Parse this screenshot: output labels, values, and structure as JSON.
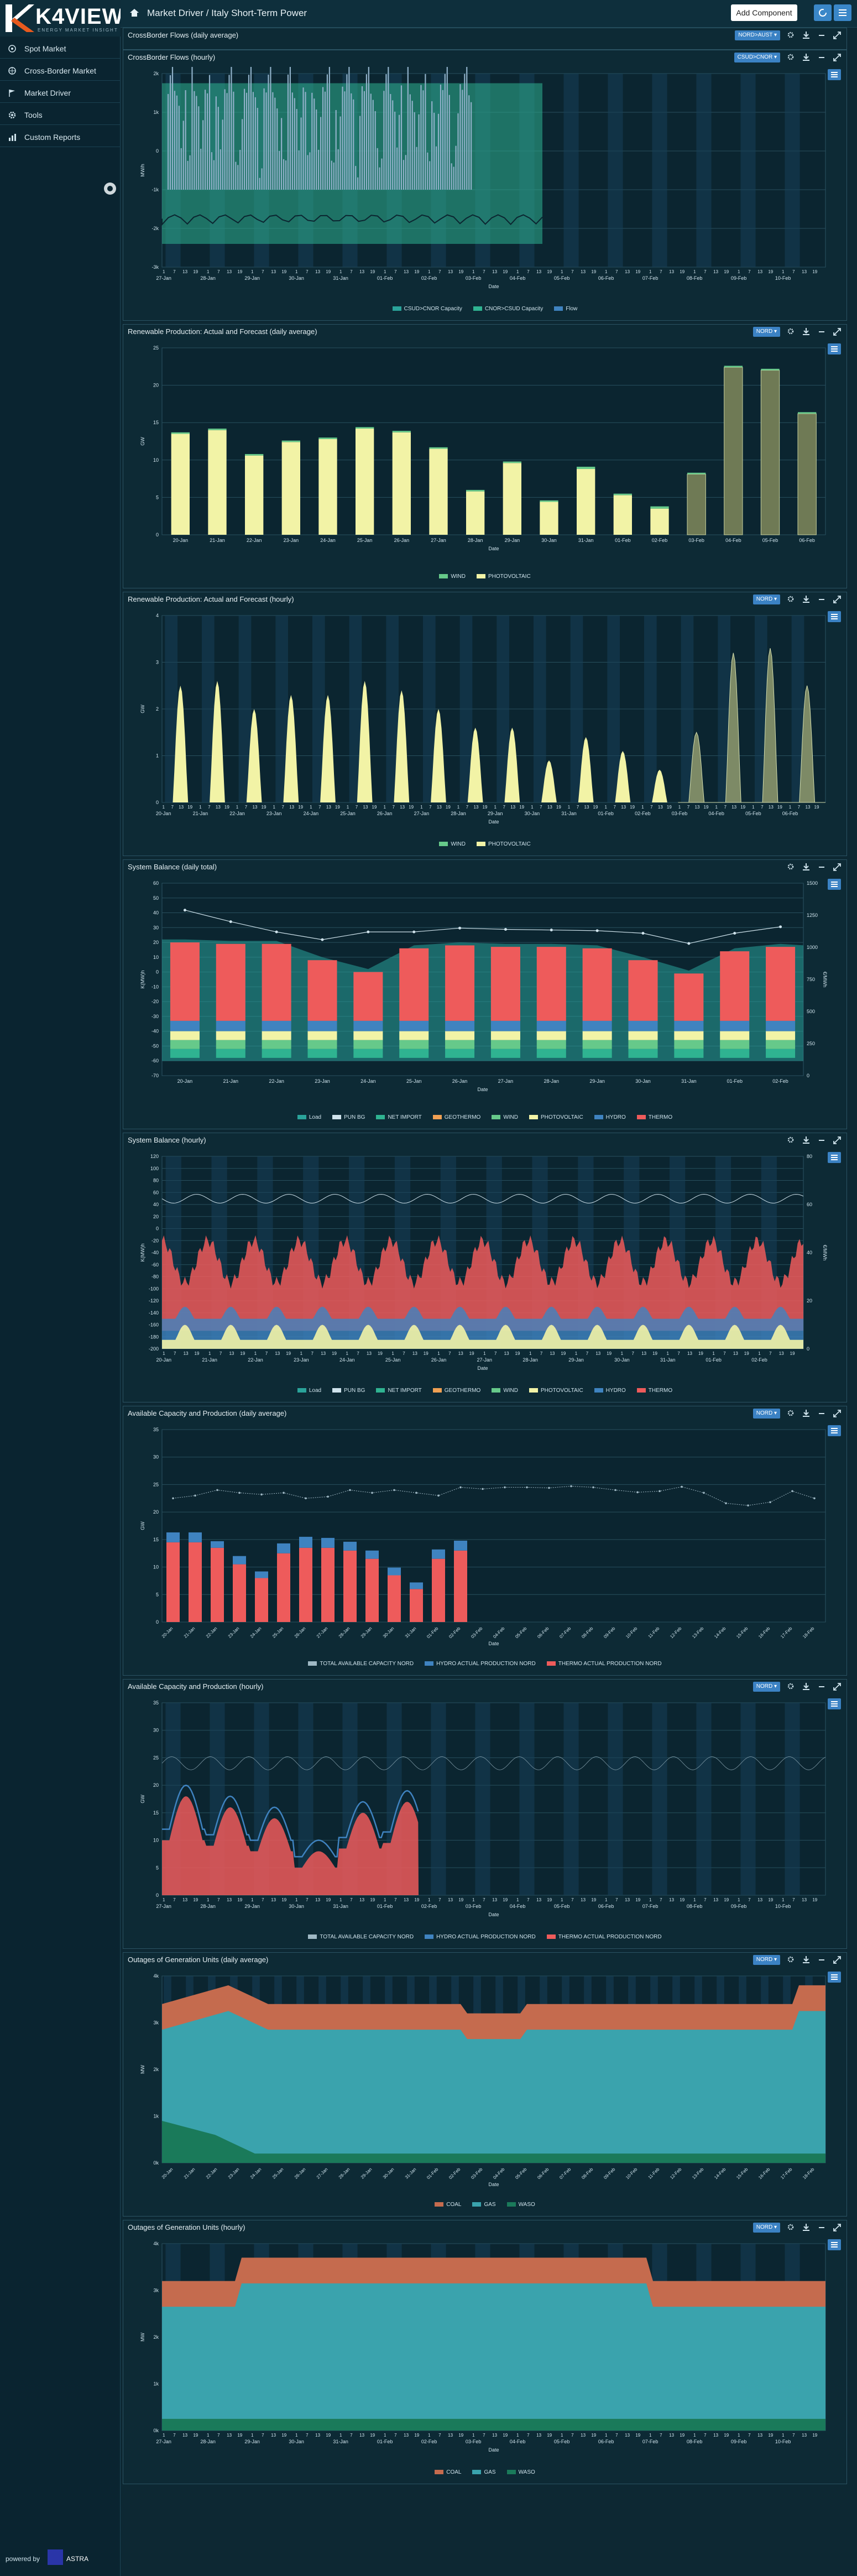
{
  "app": {
    "brand": "K4VIEW",
    "tagline": "ENERGY MARKET INSIGHT",
    "breadcrumb": "Market Driver / Italy Short-Term Power",
    "add_component": "Add Component",
    "powered_by": "powered by",
    "company": "ASTRA"
  },
  "sidebar": {
    "items": [
      {
        "label": "Spot Market",
        "icon": "spot-icon"
      },
      {
        "label": "Cross-Border Market",
        "icon": "crossborder-icon"
      },
      {
        "label": "Market Driver",
        "icon": "flag-icon"
      },
      {
        "label": "Tools",
        "icon": "gear-icon"
      },
      {
        "label": "Custom Reports",
        "icon": "chart-icon"
      }
    ]
  },
  "colors": {
    "accent": "#3b82c4",
    "bg": "#0d2833",
    "wind": "#66c98a",
    "pv": "#f2f3a6",
    "thermo": "#ee5b5b",
    "hydro": "#3f83c0",
    "geo": "#f0a053",
    "import": "#2fb391",
    "load": "#2aa39a",
    "coal": "#c56b4e",
    "gas": "#3aa3ad",
    "waso": "#1a7a5a",
    "flow": "#8fb0c8"
  },
  "panels": [
    {
      "title": "CrossBorder Flows (daily average)",
      "select": "NORD>AUST"
    },
    {
      "title": "CrossBorder Flows (hourly)",
      "select": "CSUD>CNOR",
      "chart_data": {
        "type": "area",
        "ylabel": "MW/h",
        "xlabel": "Date",
        "yticks": [
          "2k",
          "1k",
          "0",
          "-1k",
          "-2k",
          "-3k"
        ],
        "categories": [
          "27-Jan",
          "28-Jan",
          "29-Jan",
          "30-Jan",
          "31-Jan",
          "01-Feb",
          "02-Feb",
          "03-Feb",
          "04-Feb",
          "05-Feb",
          "06-Feb",
          "07-Feb",
          "08-Feb",
          "09-Feb",
          "10-Feb"
        ],
        "legend": [
          "CSUD>CNOR Capacity",
          "CNOR>CSUD Capacity",
          "Flow"
        ]
      }
    },
    {
      "title": "Renewable Production: Actual and Forecast (daily average)",
      "select": "NORD",
      "chart_data": {
        "type": "bar",
        "ylabel": "GW",
        "xlabel": "Date",
        "yticks": [
          "25",
          "20",
          "15",
          "10",
          "5",
          "0"
        ],
        "ylim": [
          0,
          25
        ],
        "categories": [
          "20-Jan",
          "21-Jan",
          "22-Jan",
          "23-Jan",
          "24-Jan",
          "25-Jan",
          "26-Jan",
          "27-Jan",
          "28-Jan",
          "29-Jan",
          "30-Jan",
          "31-Jan",
          "01-Feb",
          "02-Feb",
          "03-Feb",
          "04-Feb",
          "05-Feb",
          "06-Feb"
        ],
        "series": [
          {
            "name": "WIND",
            "values": [
              0.2,
              0.2,
              0.2,
              0.2,
              0.2,
              0.2,
              0.2,
              0.2,
              0.2,
              0.2,
              0.2,
              0.3,
              0.2,
              0.3,
              0.2,
              0.2,
              0.2,
              0.2
            ]
          },
          {
            "name": "PHOTOVOLTAIC",
            "values": [
              13.5,
              14,
              10.6,
              12.4,
              12.8,
              14.2,
              13.7,
              11.5,
              5.8,
              9.6,
              4.4,
              8.8,
              5.3,
              3.5,
              8.1,
              22.4,
              22,
              16.2
            ]
          }
        ],
        "legend": [
          "WIND",
          "PHOTOVOLTAIC"
        ]
      }
    },
    {
      "title": "Renewable Production: Actual and Forecast (hourly)",
      "select": "NORD",
      "chart_data": {
        "type": "area",
        "ylabel": "GW",
        "xlabel": "Date",
        "yticks": [
          "4",
          "3",
          "2",
          "1",
          "0"
        ],
        "ylim": [
          0,
          4
        ],
        "categories": [
          "20-Jan",
          "21-Jan",
          "22-Jan",
          "23-Jan",
          "24-Jan",
          "25-Jan",
          "26-Jan",
          "27-Jan",
          "28-Jan",
          "29-Jan",
          "30-Jan",
          "31-Jan",
          "01-Feb",
          "02-Feb",
          "03-Feb",
          "04-Feb",
          "05-Feb",
          "06-Feb"
        ],
        "peaks": [
          2.5,
          2.6,
          2.0,
          2.3,
          2.3,
          2.6,
          2.4,
          2.0,
          1.6,
          1.6,
          0.9,
          1.4,
          1.1,
          0.7,
          1.5,
          3.2,
          3.3,
          2.5
        ],
        "legend": [
          "WIND",
          "PHOTOVOLTAIC"
        ]
      }
    },
    {
      "title": "System Balance (daily total)",
      "chart_data": {
        "type": "bar",
        "ylabel": "K(MW)h",
        "y2label": "€/MWh",
        "xlabel": "Date",
        "yticks": [
          "60",
          "50",
          "40",
          "30",
          "20",
          "10",
          "0",
          "-10",
          "-20",
          "-30",
          "-40",
          "-50",
          "-60",
          "-70"
        ],
        "y2ticks": [
          "1500",
          "1250",
          "1000",
          "750",
          "500",
          "250",
          "0"
        ],
        "categories": [
          "20-Jan",
          "21-Jan",
          "22-Jan",
          "23-Jan",
          "24-Jan",
          "25-Jan",
          "26-Jan",
          "27-Jan",
          "28-Jan",
          "29-Jan",
          "30-Jan",
          "31-Jan",
          "01-Feb",
          "02-Feb"
        ],
        "thermo_top": [
          20,
          19,
          19,
          8,
          0,
          16,
          18,
          17,
          17,
          16,
          8,
          -1,
          14,
          17
        ],
        "pun": [
          1290,
          1200,
          1120,
          1060,
          1120,
          1120,
          1150,
          1140,
          1135,
          1130,
          1110,
          1030,
          1110,
          1160
        ],
        "legend": [
          "Load",
          "PUN BG",
          "NET IMPORT",
          "GEOTHERMO",
          "WIND",
          "PHOTOVOLTAIC",
          "HYDRO",
          "THERMO"
        ]
      }
    },
    {
      "title": "System Balance (hourly)",
      "chart_data": {
        "type": "area",
        "ylabel": "K(MW)h",
        "y2label": "€/MWh",
        "xlabel": "Date",
        "yticks": [
          "120",
          "100",
          "80",
          "60",
          "40",
          "20",
          "0",
          "-20",
          "-40",
          "-60",
          "-80",
          "-100",
          "-120",
          "-140",
          "-160",
          "-180",
          "-200"
        ],
        "y2ticks": [
          "80",
          "60",
          "40",
          "20",
          "0"
        ],
        "categories": [
          "20-Jan",
          "21-Jan",
          "22-Jan",
          "23-Jan",
          "24-Jan",
          "25-Jan",
          "26-Jan",
          "27-Jan",
          "28-Jan",
          "29-Jan",
          "30-Jan",
          "31-Jan",
          "01-Feb",
          "02-Feb"
        ],
        "legend": [
          "Load",
          "PUN BG",
          "NET IMPORT",
          "GEOTHERMO",
          "WIND",
          "PHOTOVOLTAIC",
          "HYDRO",
          "THERMO"
        ]
      }
    },
    {
      "title": "Available Capacity and Production (daily average)",
      "select": "NORD",
      "chart_data": {
        "type": "bar",
        "ylabel": "GW",
        "xlabel": "Date",
        "yticks": [
          "35",
          "30",
          "25",
          "20",
          "15",
          "10",
          "5",
          "0"
        ],
        "ylim": [
          0,
          35
        ],
        "categories": [
          "20-Jan",
          "21-Jan",
          "22-Jan",
          "23-Jan",
          "24-Jan",
          "25-Jan",
          "26-Jan",
          "27-Jan",
          "28-Jan",
          "29-Jan",
          "30-Jan",
          "31-Jan",
          "01-Feb",
          "02-Feb",
          "03-Feb",
          "04-Feb",
          "05-Feb",
          "06-Feb",
          "07-Feb",
          "08-Feb",
          "09-Feb",
          "10-Feb",
          "11-Feb",
          "12-Feb",
          "13-Feb",
          "14-Feb",
          "15-Feb",
          "16-Feb",
          "17-Feb",
          "18-Feb"
        ],
        "thermo": [
          14.5,
          14.5,
          13.5,
          10.5,
          8,
          12.5,
          13.5,
          13.5,
          13,
          11.5,
          8.5,
          6,
          11.5,
          13
        ],
        "hydro": [
          1.8,
          1.8,
          1.2,
          1.5,
          1.2,
          1.8,
          2,
          1.8,
          1.6,
          1.5,
          1.4,
          1.2,
          1.7,
          1.8
        ],
        "capacity": [
          22.5,
          23,
          24,
          23.5,
          23.2,
          23.5,
          22.5,
          22.8,
          24,
          23.5,
          24,
          23.5,
          23,
          24.5,
          24.2,
          24.5,
          24.5,
          24.4,
          24.7,
          24.5,
          24,
          23.6,
          23.8,
          24.6,
          23.5,
          21.6,
          21.2,
          21.8,
          23.8,
          22.5
        ],
        "legend": [
          "TOTAL AVAILABLE CAPACITY NORD",
          "HYDRO ACTUAL PRODUCTION NORD",
          "THERMO ACTUAL PRODUCTION NORD"
        ]
      }
    },
    {
      "title": "Available Capacity and Production (hourly)",
      "select": "NORD",
      "chart_data": {
        "type": "area",
        "ylabel": "GW",
        "xlabel": "Date",
        "yticks": [
          "35",
          "30",
          "25",
          "20",
          "15",
          "10",
          "5",
          "0"
        ],
        "ylim": [
          0,
          35
        ],
        "categories": [
          "27-Jan",
          "28-Jan",
          "29-Jan",
          "30-Jan",
          "31-Jan",
          "01-Feb",
          "02-Feb",
          "03-Feb",
          "04-Feb",
          "05-Feb",
          "06-Feb",
          "07-Feb",
          "08-Feb",
          "09-Feb",
          "10-Feb"
        ],
        "legend": [
          "TOTAL AVAILABLE CAPACITY NORD",
          "HYDRO ACTUAL PRODUCTION NORD",
          "THERMO ACTUAL PRODUCTION NORD"
        ]
      }
    },
    {
      "title": "Outages of Generation Units (daily average)",
      "select": "NORD",
      "chart_data": {
        "type": "area",
        "ylabel": "MW",
        "xlabel": "Date",
        "yticks": [
          "4k",
          "3k",
          "2k",
          "1k",
          "0k"
        ],
        "categories": [
          "20-Jan",
          "21-Jan",
          "22-Jan",
          "23-Jan",
          "24-Jan",
          "25-Jan",
          "26-Jan",
          "27-Jan",
          "28-Jan",
          "29-Jan",
          "30-Jan",
          "31-Jan",
          "01-Feb",
          "02-Feb",
          "03-Feb",
          "04-Feb",
          "05-Feb",
          "06-Feb",
          "07-Feb",
          "08-Feb",
          "09-Feb",
          "10-Feb",
          "11-Feb",
          "12-Feb",
          "13-Feb",
          "14-Feb",
          "15-Feb",
          "16-Feb",
          "17-Feb",
          "18-Feb"
        ],
        "legend": [
          "COAL",
          "GAS",
          "WASO"
        ]
      }
    },
    {
      "title": "Outages of Generation Units (hourly)",
      "select": "NORD",
      "chart_data": {
        "type": "area",
        "ylabel": "MW",
        "xlabel": "Date",
        "yticks": [
          "4k",
          "3k",
          "2k",
          "1k",
          "0k"
        ],
        "categories": [
          "27-Jan",
          "28-Jan",
          "29-Jan",
          "30-Jan",
          "31-Jan",
          "01-Feb",
          "02-Feb",
          "03-Feb",
          "04-Feb",
          "05-Feb",
          "06-Feb",
          "07-Feb",
          "08-Feb",
          "09-Feb",
          "10-Feb"
        ],
        "legend": [
          "COAL",
          "GAS",
          "WASO"
        ]
      }
    }
  ]
}
